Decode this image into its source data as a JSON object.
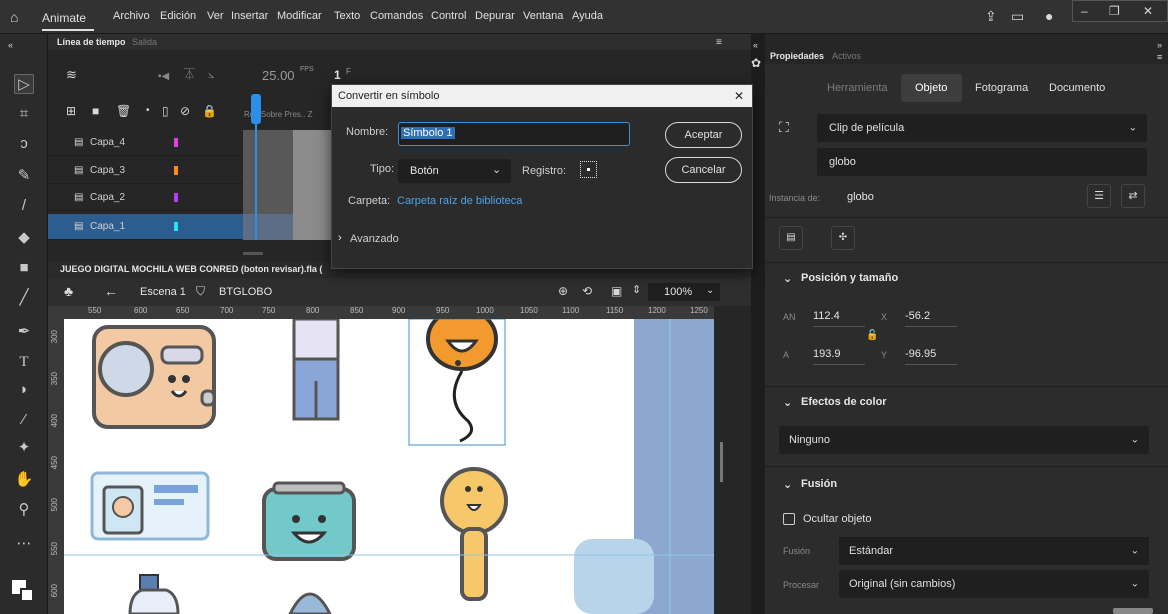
{
  "menu": {
    "app_name": "Animate",
    "items": [
      "Archivo",
      "Edición",
      "Ver",
      "Insertar",
      "Modificar",
      "Texto",
      "Comandos",
      "Control",
      "Depurar",
      "Ventana",
      "Ayuda"
    ]
  },
  "timeline": {
    "tab_active": "Línea de tiempo",
    "tab_inactive": "Salida",
    "fps": "25.00",
    "fps_unit": "FPS",
    "frame": "1",
    "frame_unit": "F",
    "col_headers": "Re.. Sobre Pres.. Z",
    "layers": [
      {
        "name": "Capa_4",
        "color": "#e040e0"
      },
      {
        "name": "Capa_3",
        "color": "#ff8c1a"
      },
      {
        "name": "Capa_2",
        "color": "#b040f0"
      },
      {
        "name": "Capa_1",
        "color": "#28e0f0"
      }
    ]
  },
  "document": {
    "title": "JUEGO DIGITAL MOCHILA WEB CONRED (boton revisar).fla (",
    "scene": "Escena 1",
    "symbol": "BTGLOBO",
    "zoom": "100%"
  },
  "ruler": {
    "h": [
      "550",
      "600",
      "650",
      "700",
      "750",
      "800",
      "850",
      "900",
      "950",
      "1000",
      "1050",
      "1100",
      "1150",
      "1200",
      "1250"
    ],
    "v": [
      "300",
      "350",
      "400",
      "450",
      "500",
      "550",
      "600"
    ]
  },
  "dialog": {
    "title": "Convertir en símbolo",
    "name_label": "Nombre:",
    "name_value": "Símbolo 1",
    "type_label": "Tipo:",
    "type_value": "Botón",
    "registro_label": "Registro:",
    "folder_label": "Carpeta:",
    "folder_value": "Carpeta raíz de biblioteca",
    "advanced_label": "Avanzado",
    "ok_label": "Aceptar",
    "cancel_label": "Cancelar"
  },
  "properties": {
    "tab_active": "Propiedades",
    "tab_inactive": "Activos",
    "subtabs": [
      "Herramienta",
      "Objeto",
      "Fotograma",
      "Documento"
    ],
    "selected_subtab": "Objeto",
    "symbol_type": "Clip de película",
    "instance_name": "globo",
    "instance_of_label": "Instancia de:",
    "instance_of_value": "globo",
    "position_title": "Posición y tamaño",
    "an_label": "AN",
    "an_value": "112.4",
    "x_label": "X",
    "x_value": "-56.2",
    "a_label": "A",
    "a_value": "193.9",
    "y_label": "Y",
    "y_value": "-96.95",
    "color_effects_title": "Efectos de color",
    "color_effect_value": "Ninguno",
    "blend_title": "Fusión",
    "hide_object_label": "Ocultar objeto",
    "blend_label": "Fusión",
    "blend_value": "Estándar",
    "process_label": "Procesar",
    "process_value": "Original (sin cambios)"
  }
}
